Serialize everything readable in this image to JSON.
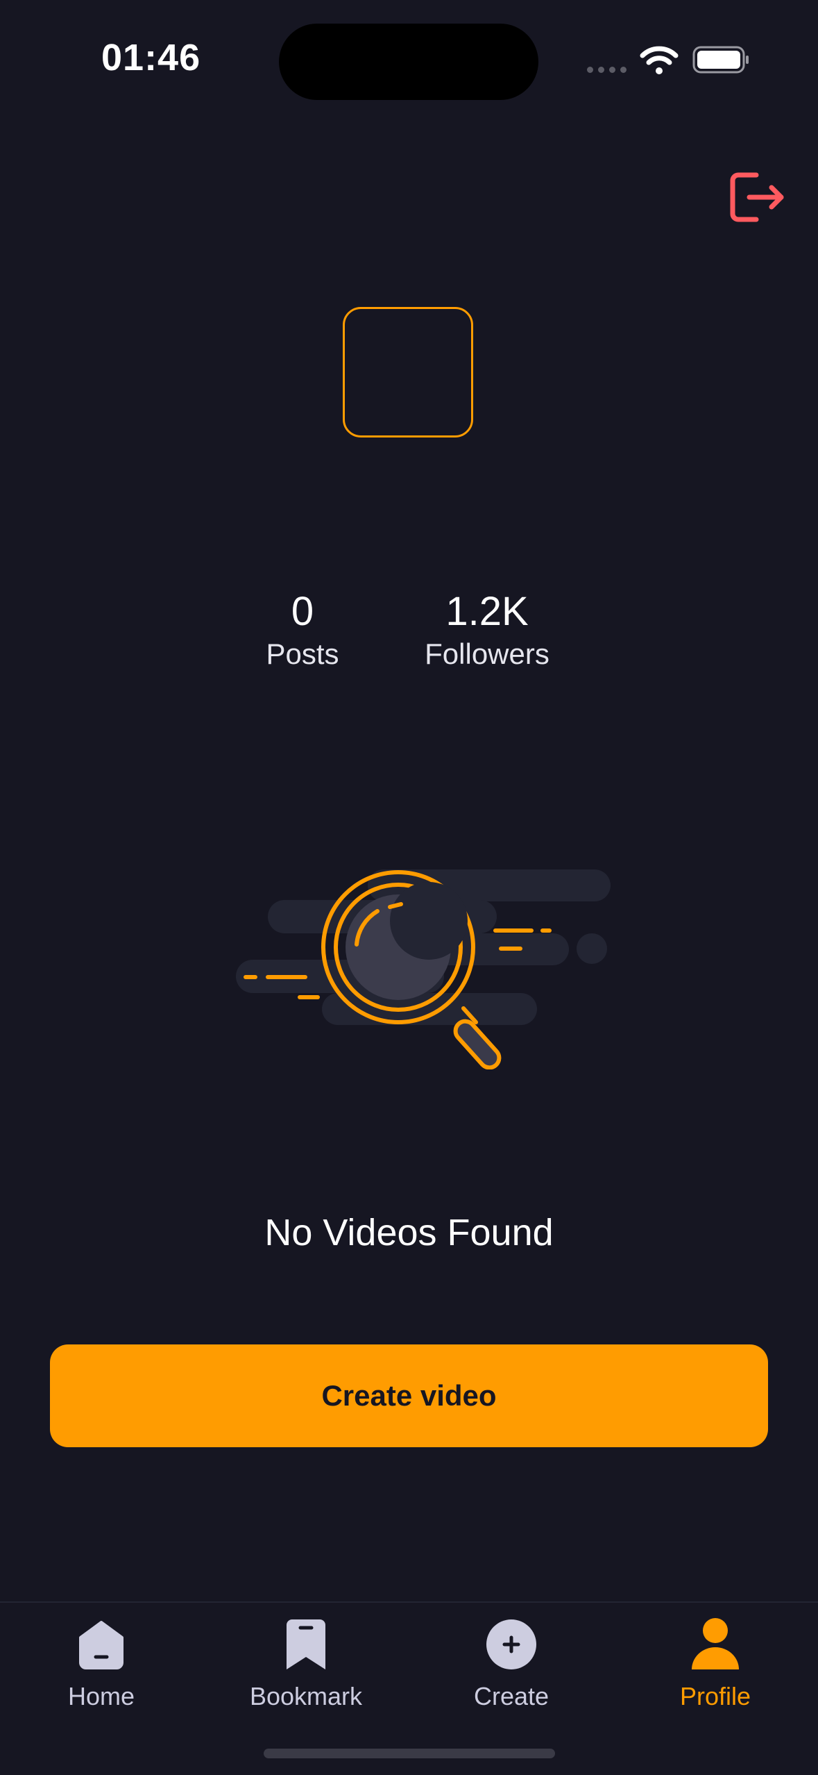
{
  "status_bar": {
    "time": "01:46"
  },
  "profile": {
    "stats": [
      {
        "value": "0",
        "label": "Posts"
      },
      {
        "value": "1.2K",
        "label": "Followers"
      }
    ]
  },
  "empty_state": {
    "title": "No Videos Found",
    "button_label": "Create video"
  },
  "tabs": [
    {
      "label": "Home",
      "icon": "home-icon",
      "active": false
    },
    {
      "label": "Bookmark",
      "icon": "bookmark-icon",
      "active": false
    },
    {
      "label": "Create",
      "icon": "plus-circle-icon",
      "active": false
    },
    {
      "label": "Profile",
      "icon": "profile-icon",
      "active": true
    }
  ],
  "colors": {
    "background": "#161622",
    "accent": "#ff9c01",
    "logout": "#ff5a5f",
    "tab_inactive": "#cdcde0"
  }
}
